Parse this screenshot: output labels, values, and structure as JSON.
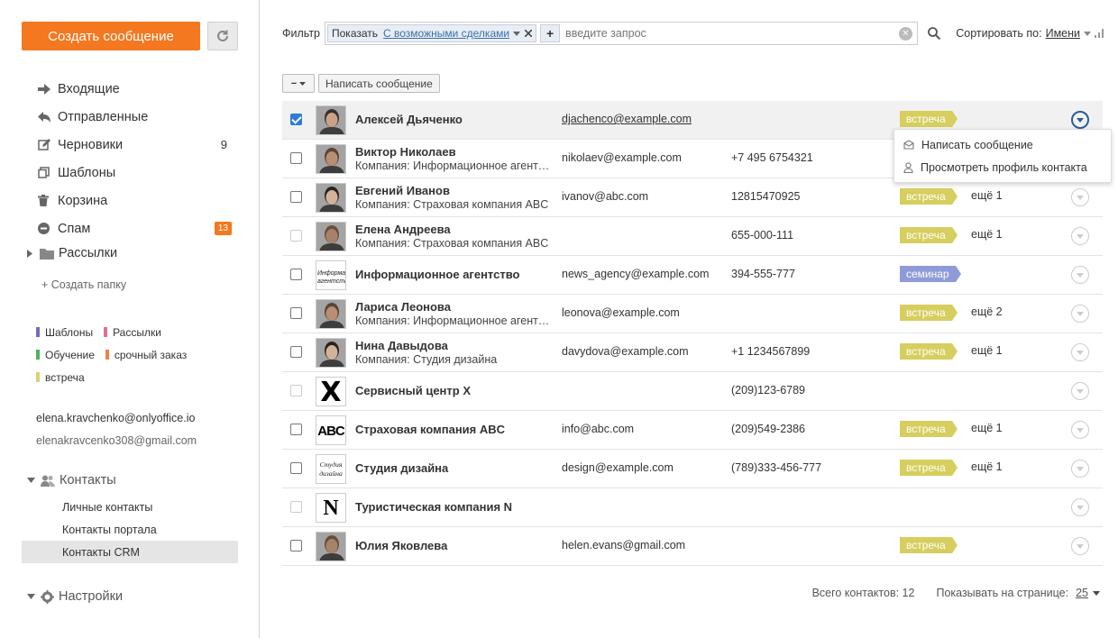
{
  "sidebar": {
    "create_button": "Создать сообщение",
    "folders": [
      {
        "label": "Входящие",
        "count": "",
        "icon": "inbox-arrow-icon"
      },
      {
        "label": "Отправленные",
        "count": "",
        "icon": "sent-icon"
      },
      {
        "label": "Черновики",
        "count": "9",
        "icon": "drafts-icon"
      },
      {
        "label": "Шаблоны",
        "count": "",
        "icon": "templates-icon"
      },
      {
        "label": "Корзина",
        "count": "",
        "icon": "trash-icon"
      },
      {
        "label": "Спам",
        "count": "13",
        "icon": "spam-icon"
      }
    ],
    "mailing": "Рассылки",
    "create_folder": "+ Создать папку",
    "tags": [
      {
        "label": "Шаблоны",
        "color": "#7a69b5"
      },
      {
        "label": "Рассылки",
        "color": "#e36f96"
      },
      {
        "label": "Обучение",
        "color": "#4cb25c"
      },
      {
        "label": "срочный заказ",
        "color": "#f0804d"
      },
      {
        "label": "встреча",
        "color": "#d9d374"
      }
    ],
    "accounts": [
      "elena.kravchenko@onlyoffice.io",
      "elenakravcenko308@gmail.com"
    ],
    "contacts_header": "Контакты",
    "contact_items": [
      "Личные контакты",
      "Контакты портала",
      "Контакты CRM"
    ],
    "settings": "Настройки"
  },
  "filter": {
    "label": "Фильтр",
    "chip_key": "Показать",
    "chip_value": "С возможными сделками",
    "placeholder": "введите запрос"
  },
  "sort": {
    "label": "Сортировать по:",
    "value": "Имени"
  },
  "actions": {
    "write": "Написать сообщение"
  },
  "popup": {
    "write": "Написать сообщение",
    "profile": "Просмотреть профиль контакта"
  },
  "contacts": [
    {
      "name": "Алексей Дьяченко",
      "company": "",
      "email": "djachenco@example.com",
      "phone": "",
      "tag": "встреча",
      "more": "",
      "checked": true,
      "disabled": false
    },
    {
      "name": "Виктор Николаев",
      "company": "Компания: Информационное агентство",
      "email": "nikolaev@example.com",
      "phone": "+7 495 6754321",
      "tag": "",
      "more": "",
      "checked": false,
      "disabled": false
    },
    {
      "name": "Евгений Иванов",
      "company": "Компания: Страховая компания ABC",
      "email": "ivanov@abc.com",
      "phone": "12815470925",
      "tag": "встреча",
      "more": "ещё 1",
      "checked": false,
      "disabled": false
    },
    {
      "name": "Елена Андреева",
      "company": "Компания: Страховая компания ABC",
      "email": "",
      "phone": "655-000-111",
      "tag": "встреча",
      "more": "ещё 1",
      "checked": false,
      "disabled": true
    },
    {
      "name": "Информационное агентство",
      "company": "",
      "email": "news_agency@example.com",
      "phone": "394-555-777",
      "tag": "семинар",
      "more": "",
      "checked": false,
      "disabled": false
    },
    {
      "name": "Лариса Леонова",
      "company": "Компания: Информационное агентство",
      "email": "leonova@example.com",
      "phone": "",
      "tag": "встреча",
      "more": "ещё 2",
      "checked": false,
      "disabled": false
    },
    {
      "name": "Нина Давыдова",
      "company": "Компания: Студия дизайна",
      "email": "davydova@example.com",
      "phone": "+1 1234567899",
      "tag": "встреча",
      "more": "ещё 1",
      "checked": false,
      "disabled": false
    },
    {
      "name": "Сервисный центр X",
      "company": "",
      "email": "",
      "phone": "(209)123-6789",
      "tag": "",
      "more": "",
      "checked": false,
      "disabled": true
    },
    {
      "name": "Страховая компания ABC",
      "company": "",
      "email": "info@abc.com",
      "phone": "(209)549-2386",
      "tag": "встреча",
      "more": "ещё 1",
      "checked": false,
      "disabled": false
    },
    {
      "name": "Студия дизайна",
      "company": "",
      "email": "design@example.com",
      "phone": "(789)333-456-777",
      "tag": "встреча",
      "more": "ещё 1",
      "checked": false,
      "disabled": false
    },
    {
      "name": "Туристическая компания N",
      "company": "",
      "email": "",
      "phone": "",
      "tag": "",
      "more": "",
      "checked": false,
      "disabled": true
    },
    {
      "name": "Юлия Яковлева",
      "company": "",
      "email": "helen.evans@gmail.com",
      "phone": "",
      "tag": "встреча",
      "more": "",
      "checked": false,
      "disabled": false
    }
  ],
  "avatars": {
    "4": "Информационное агентство",
    "7": "X",
    "8": "ABC",
    "9": "Студия дизайна",
    "10": "N"
  },
  "tag_colors": {
    "встреча": "#d6ce5e",
    "семинар": "#8f9bd8"
  },
  "footer": {
    "total_label": "Всего контактов: 12",
    "per_page_label": "Показывать на странице:",
    "per_page_value": "25"
  },
  "colors": {
    "accent": "#f4781f",
    "link": "#3a6fa8",
    "check": "#2f7ad8"
  }
}
